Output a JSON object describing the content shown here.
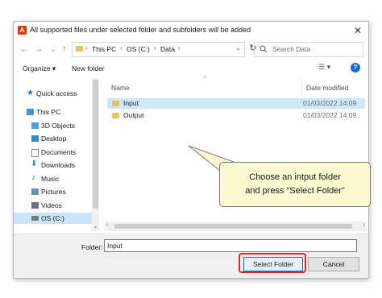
{
  "window": {
    "title": "All supported files under selected folder and subfolders will be added",
    "close": "✕"
  },
  "navigation": {
    "back": "←",
    "forward": "→",
    "recent": "⌄",
    "up": "↑",
    "breadcrumb": [
      "This PC",
      "OS (C:)",
      "Data"
    ],
    "refresh": "↻",
    "search_placeholder": "Search Data"
  },
  "toolbar": {
    "organize": "Organize ▾",
    "new_folder": "New folder",
    "view": "☰ ▾",
    "help": "?"
  },
  "sidebar": {
    "items": [
      {
        "label": "Quick access",
        "icon": "star-icon",
        "color": "#1a6fc9"
      },
      {
        "label": "This PC",
        "icon": "computer-icon",
        "color": "#4a90d9"
      },
      {
        "label": "3D Objects",
        "icon": "cube-icon",
        "color": "#4aa3df"
      },
      {
        "label": "Desktop",
        "icon": "desktop-icon",
        "color": "#2b88d8"
      },
      {
        "label": "Documents",
        "icon": "document-icon",
        "color": "#8a8a8a"
      },
      {
        "label": "Downloads",
        "icon": "download-icon",
        "color": "#2b88d8"
      },
      {
        "label": "Music",
        "icon": "music-icon",
        "color": "#2b6fb6"
      },
      {
        "label": "Pictures",
        "icon": "picture-icon",
        "color": "#6d8fb3"
      },
      {
        "label": "Videos",
        "icon": "video-icon",
        "color": "#6d6d8a"
      },
      {
        "label": "OS (C:)",
        "icon": "drive-icon",
        "color": "#7a7a7a"
      }
    ],
    "selected_index": 9
  },
  "file_list": {
    "columns": {
      "name": "Name",
      "date": "Date modified"
    },
    "rows": [
      {
        "name": "Input",
        "date": "01/03/2022 14:09",
        "selected": true
      },
      {
        "name": "Output",
        "date": "01/03/2022 14:09",
        "selected": false
      }
    ]
  },
  "callout": {
    "line1": "Choose an intput folder",
    "line2": "and press “Select Folder”"
  },
  "footer": {
    "folder_label": "Folder:",
    "folder_value": "Input",
    "select_button": "Select Folder",
    "cancel_button": "Cancel"
  },
  "colors": {
    "accent": "#0078d7",
    "highlight": "#e0262b",
    "callout_bg": "#fcf8cf",
    "selection": "#cce8ff"
  }
}
